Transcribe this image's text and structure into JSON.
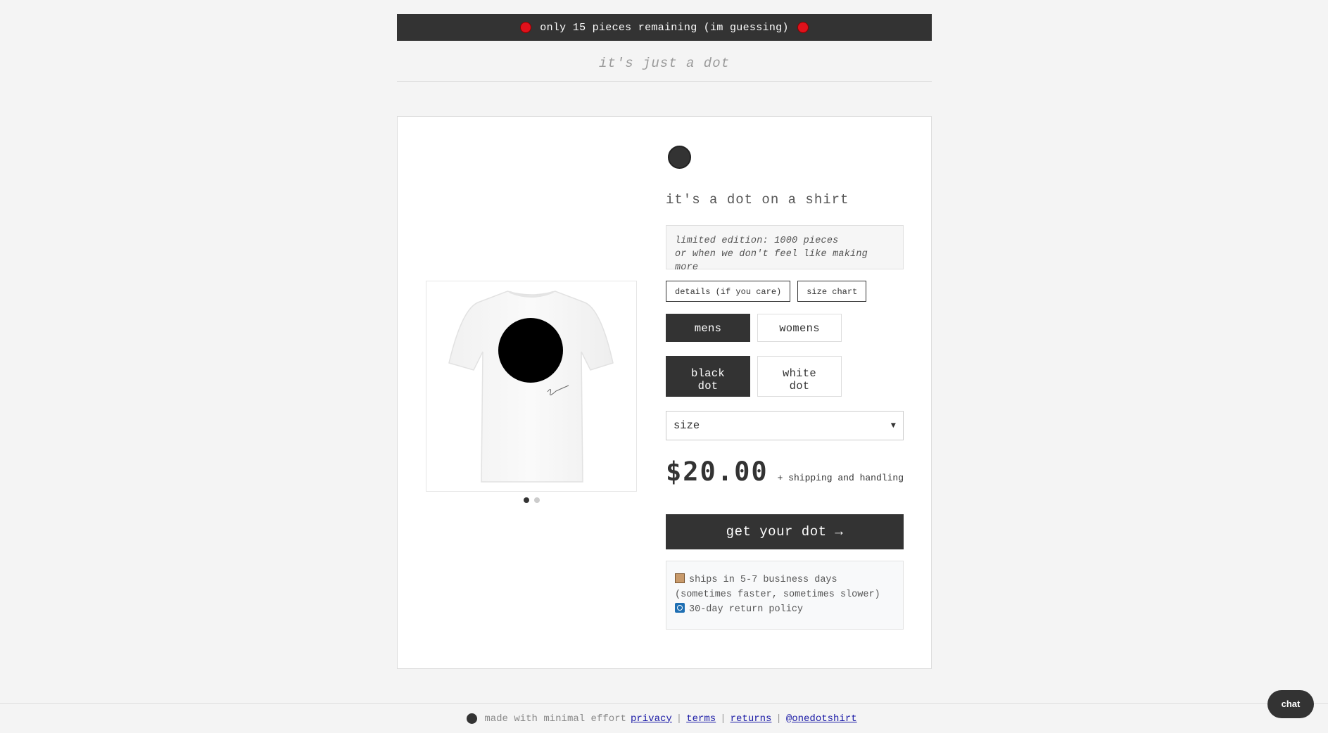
{
  "banner": {
    "text": "only 15 pieces remaining (im guessing)"
  },
  "tagline": "it's just a dot",
  "product": {
    "title": "it's a dot on a shirt",
    "note_line1": "limited edition: 1000 pieces",
    "note_line2": "or when we don't feel like making more",
    "buttons": {
      "details": "details (if you care)",
      "size_chart": "size chart"
    },
    "fit_options": [
      "mens",
      "womens"
    ],
    "selected_fit": "mens",
    "dot_options": [
      "black\ndot",
      "white\ndot"
    ],
    "selected_dot": "black dot",
    "size_select": {
      "value": "size"
    },
    "price": "$20.00",
    "shipping_note": "+ shipping and handling",
    "buy_label": "get your dot →",
    "info_ship_line1": "ships in 5-7 business days",
    "info_ship_line2": "(sometimes faster, sometimes slower)",
    "info_return": "30-day return policy",
    "gallery": {
      "slides": 2,
      "active_slide": 1
    }
  },
  "footer": {
    "tagline": "made with minimal effort",
    "links": [
      "privacy",
      "terms",
      "returns",
      "@onedotshirt"
    ],
    "separator": "|"
  },
  "chat": {
    "label": "chat"
  },
  "colors": {
    "dark": "#333333",
    "alert_red": "#e0111b",
    "bg": "#f4f4f4"
  },
  "icons": [
    "red-dot-icon",
    "box-icon",
    "return-icon",
    "chevron-down-icon"
  ]
}
